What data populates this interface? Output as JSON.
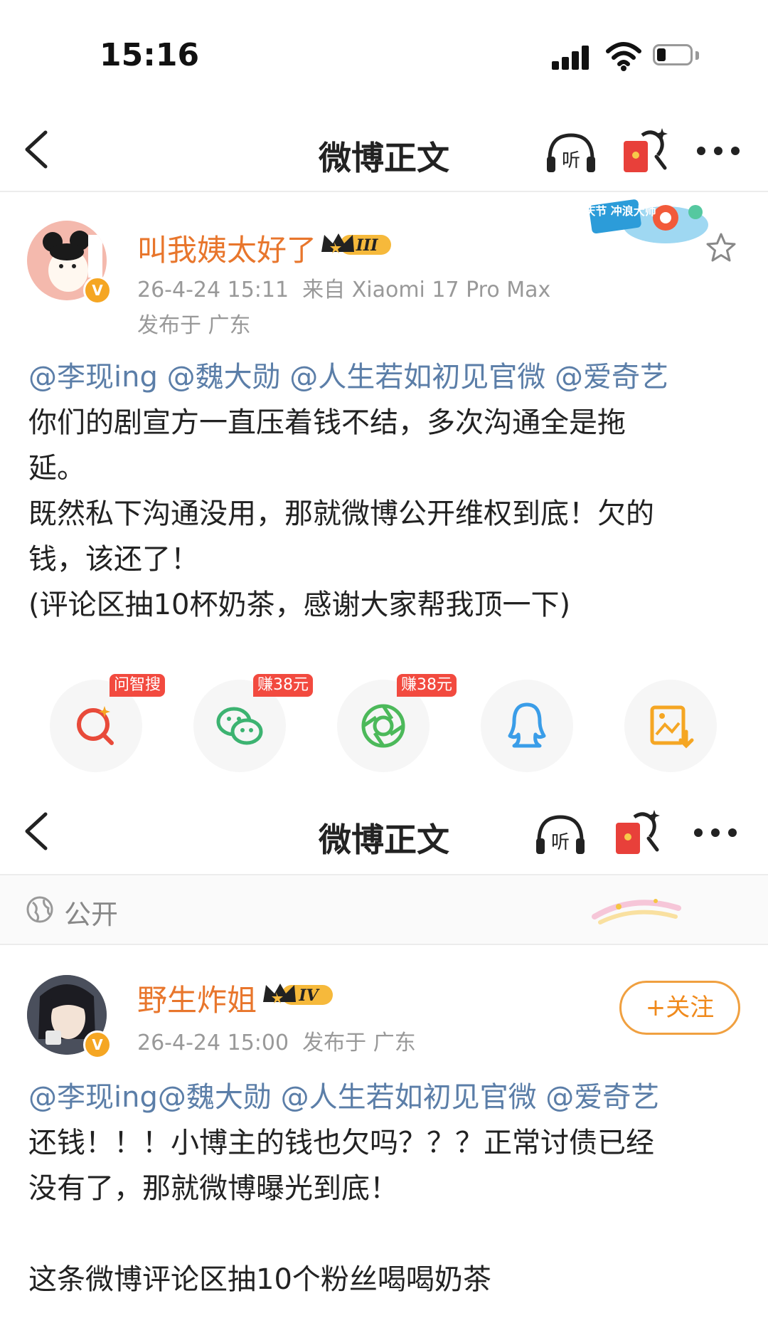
{
  "status_bar": {
    "time": "15:16"
  },
  "nav": {
    "title": "微博正文"
  },
  "post1": {
    "username": "叫我姨太好了",
    "level": "III",
    "timestamp": "26-4-24 15:11",
    "source": "来自 Xiaomi 17 Pro Max",
    "location": "发布于 广东",
    "campaign_badge": "国庆节 冲浪大师",
    "mentions": "@李现ing @魏大勋 @人生若如初见官微 @爱奇艺",
    "lines": [
      "你们的剧宣方一直压着钱不结，多次沟通全是拖",
      "延。",
      "既然私下沟通没用，那就微博公开维权到底！欠的",
      "钱，该还了！",
      "(评论区抽10杯奶茶，感谢大家帮我顶一下)"
    ]
  },
  "share": {
    "items": [
      {
        "name": "search",
        "tag": "问智搜"
      },
      {
        "name": "wechat",
        "tag": "赚38元"
      },
      {
        "name": "moments",
        "tag": "赚38元"
      },
      {
        "name": "qq",
        "tag": ""
      },
      {
        "name": "save-image",
        "tag": ""
      }
    ]
  },
  "visibility": {
    "label": "公开"
  },
  "post2": {
    "username": "野生炸姐",
    "level": "IV",
    "timestamp": "26-4-24 15:00",
    "location": "发布于 广东",
    "follow_label": "+关注",
    "mentions": "@李现ing@魏大勋 @人生若如初见官微 @爱奇艺",
    "lines": [
      "还钱！！！小博主的钱也欠吗？？？正常讨债已经",
      "没有了，那就微博曝光到底！",
      "",
      "这条微博评论区抽10个粉丝喝喝奶茶"
    ]
  },
  "colors": {
    "username": "#e8762c",
    "mention": "#5b7ea8",
    "tag": "#f24a3f",
    "follow": "#f08a1c"
  }
}
